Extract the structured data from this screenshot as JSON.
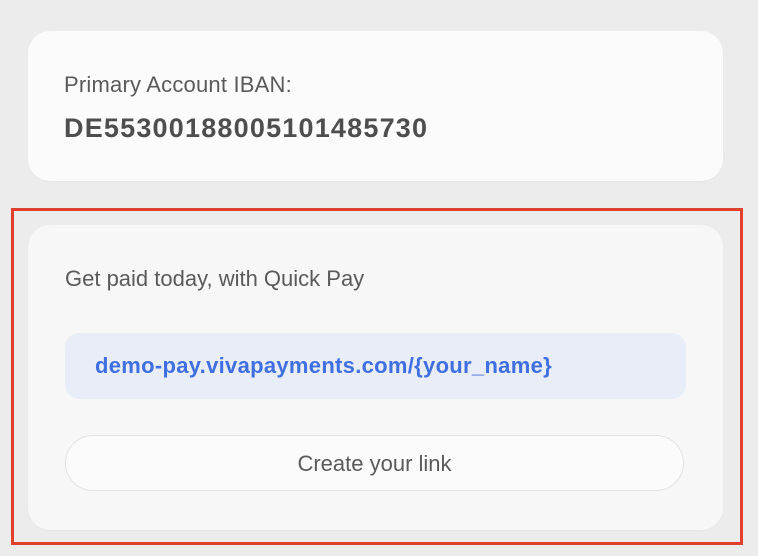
{
  "account": {
    "iban_label": "Primary Account IBAN:",
    "iban_value": "DE55300188005101485730"
  },
  "quick_pay": {
    "title": "Get paid today, with Quick Pay",
    "link": "demo-pay.vivapayments.com/{your_name}",
    "button_label": "Create your link"
  },
  "colors": {
    "background": "#ececed",
    "card": "#fbfbfb",
    "highlight_border": "#e0402c",
    "link_text": "#3f6fe0",
    "link_box": "#e8edf7"
  }
}
